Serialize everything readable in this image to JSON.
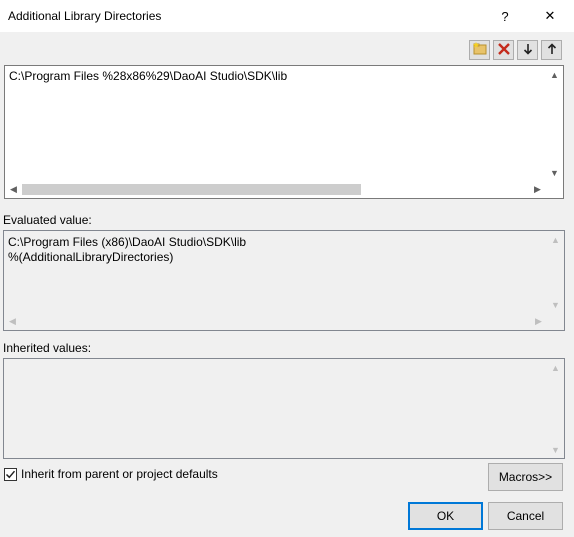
{
  "window": {
    "title": "Additional Library Directories",
    "help_label": "?",
    "close_label": "✕"
  },
  "toolbar": {
    "new_line_icon": "new-folder-icon",
    "delete_icon": "delete-icon",
    "move_down_icon": "arrow-down-icon",
    "move_up_icon": "arrow-up-icon"
  },
  "editor": {
    "lines": [
      "C:\\Program Files %28x86%29\\DaoAI Studio\\SDK\\lib"
    ]
  },
  "evaluated": {
    "label": "Evaluated value:",
    "lines": [
      "C:\\Program Files (x86)\\DaoAI Studio\\SDK\\lib",
      "%(AdditionalLibraryDirectories)"
    ]
  },
  "inherited": {
    "label": "Inherited values:"
  },
  "options": {
    "inherit_label": "Inherit from parent or project defaults",
    "inherit_checked": true
  },
  "buttons": {
    "macros": "Macros>>",
    "ok": "OK",
    "cancel": "Cancel"
  },
  "colors": {
    "focus_border": "#0078d7",
    "button_face": "#e1e1e1",
    "delete_red": "#c42b1c"
  }
}
